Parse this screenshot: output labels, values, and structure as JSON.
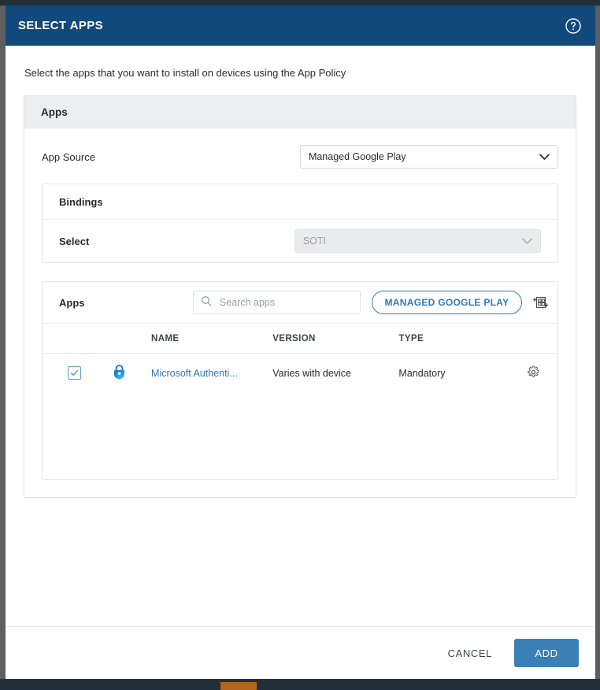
{
  "dialog": {
    "title": "SELECT APPS",
    "help_icon": "help-circle-icon",
    "intro": "Select the apps that you want to install on devices using the App Policy"
  },
  "apps_panel": {
    "header": "Apps",
    "app_source": {
      "label": "App Source",
      "value": "Managed Google Play",
      "chevron": "⌄"
    },
    "bindings": {
      "header": "Bindings",
      "select_label": "Select",
      "select_value": "SOTI",
      "chevron": "⌄"
    },
    "apps_list": {
      "title": "Apps",
      "search_placeholder": "Search apps",
      "search_value": "",
      "search_icon": "search-icon",
      "managed_google_play_button": "MANAGED GOOGLE PLAY",
      "qr_icon": "qr-scan-icon",
      "columns": [
        "NAME",
        "VERSION",
        "TYPE"
      ],
      "rows": [
        {
          "checked": true,
          "app_icon": "microsoft-authenticator-icon",
          "name": "Microsoft Authenti...",
          "version": "Varies with device",
          "type": "Mandatory",
          "settings_icon": "gear-icon"
        }
      ]
    }
  },
  "footer": {
    "cancel_label": "CANCEL",
    "add_label": "ADD"
  },
  "colors": {
    "header_blue": "#11497b",
    "accent_blue": "#2e7ab8",
    "primary_button": "#3a7fb5",
    "panel_gray": "#eceef0",
    "chrome_dark": "#222f3a",
    "accent_orange": "#b5651d"
  }
}
